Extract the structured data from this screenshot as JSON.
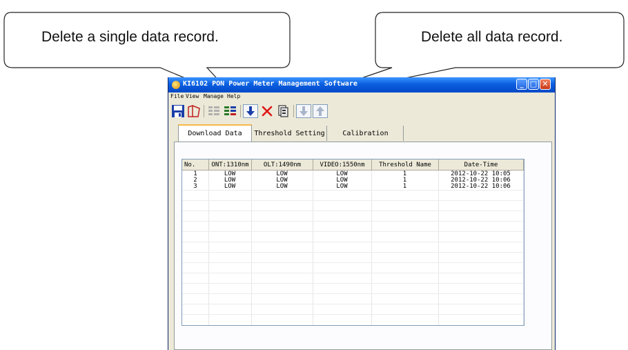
{
  "callouts": [
    {
      "text": "Delete a single data record."
    },
    {
      "text": "Delete all data record."
    }
  ],
  "window": {
    "title": "KI6102 PON Power Meter Management Software",
    "menu": [
      "File",
      "View",
      "Manage",
      "Help"
    ],
    "toolbar": [
      {
        "icon": "save-icon"
      },
      {
        "icon": "open-icon"
      },
      {
        "icon": "list-icon"
      },
      {
        "icon": "list-edit-icon"
      },
      {
        "icon": "download-arrow-icon"
      },
      {
        "icon": "delete-x-icon"
      },
      {
        "icon": "delete-all-icon"
      },
      {
        "icon": "arrow-down-disabled-icon"
      },
      {
        "icon": "arrow-up-disabled-icon"
      }
    ],
    "tabs": [
      "Download Data",
      "Threshold Setting",
      "Calibration"
    ],
    "active_tab": "Download Data"
  },
  "table": {
    "columns": [
      "No.",
      "ONT:1310nm",
      "OLT:1490nm",
      "VIDEO:1550nm",
      "Threshold Name",
      "Date-Time"
    ],
    "rows": [
      [
        "1",
        "LOW",
        "LOW",
        "LOW",
        "1",
        "2012-10-22 10:05"
      ],
      [
        "2",
        "LOW",
        "LOW",
        "LOW",
        "1",
        "2012-10-22 10:06"
      ],
      [
        "3",
        "LOW",
        "LOW",
        "LOW",
        "1",
        "2012-10-22 10:06"
      ]
    ]
  },
  "colors": {
    "titlebar": "#0a5fe0",
    "delete_red": "#e01818",
    "arrow_blue": "#1b3fa8"
  }
}
